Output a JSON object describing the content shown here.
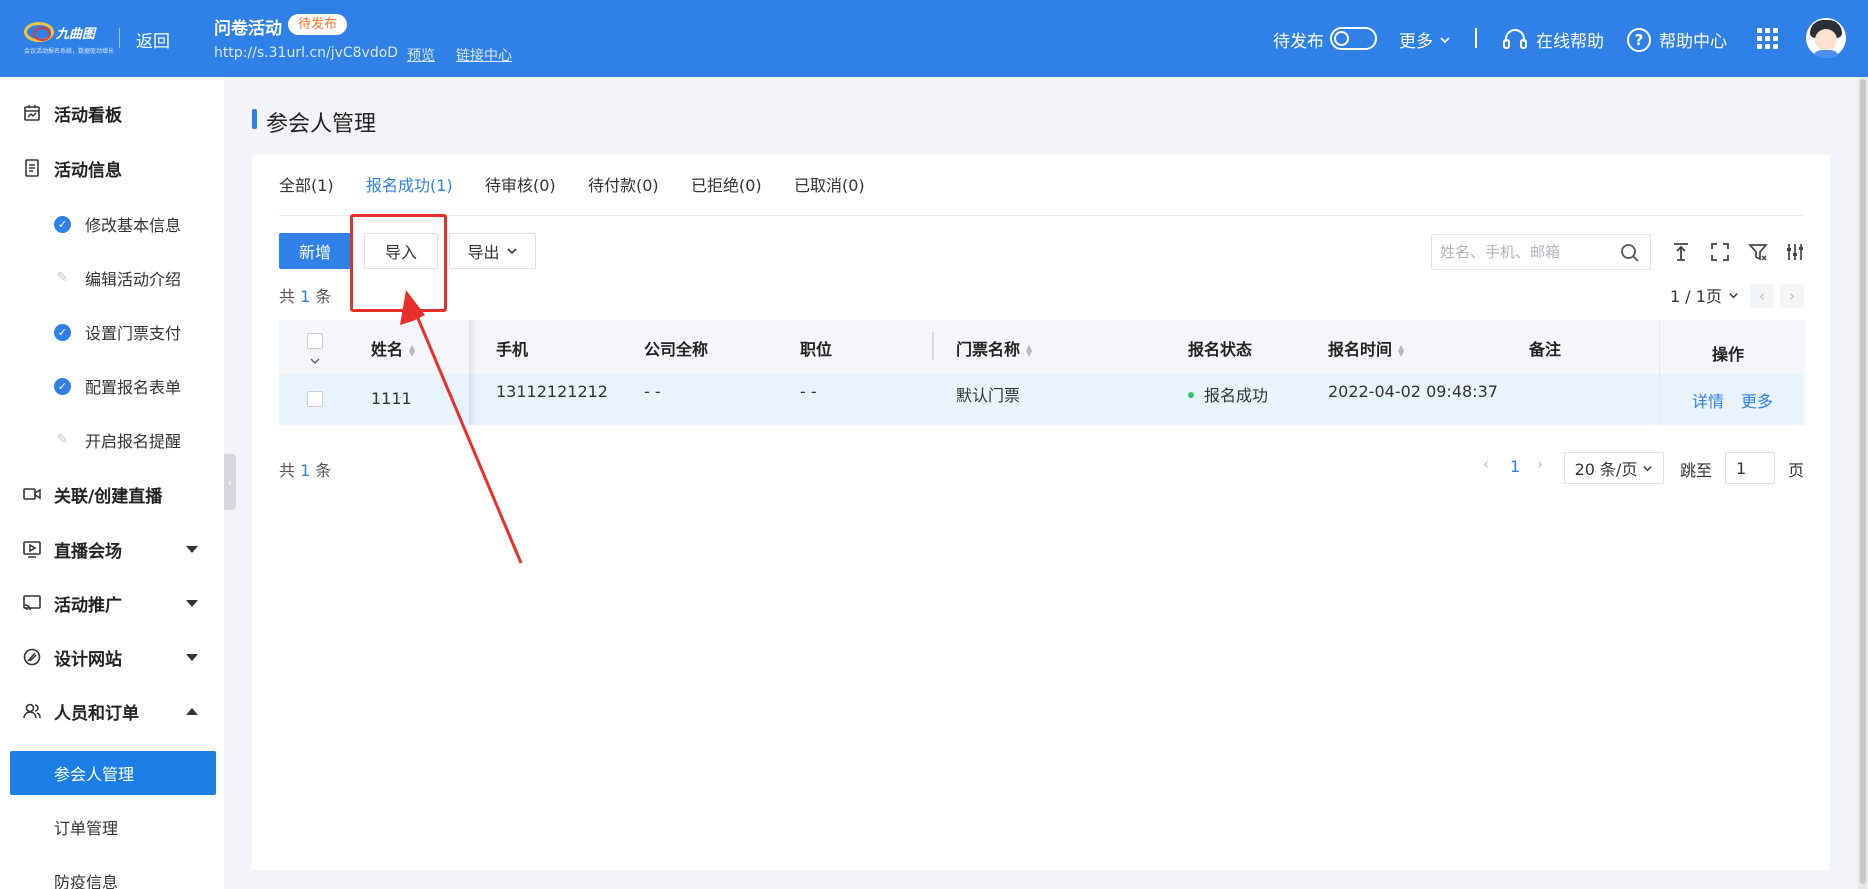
{
  "header": {
    "logo_name": "九曲图",
    "logo_tagline": "会议活动报名系统，数据驱动增长",
    "back_label": "返回",
    "activity_title": "问卷活动",
    "activity_status": "待发布",
    "activity_url": "http://s.31url.cn/jvC8vdoD",
    "preview_label": "预览",
    "link_center_label": "链接中心",
    "publish_toggle_label": "待发布",
    "more_label": "更多",
    "online_help_label": "在线帮助",
    "help_center_label": "帮助中心",
    "colors": {
      "bar": "#2f80e7",
      "status_text": "#f5732a"
    }
  },
  "sidebar": {
    "items": [
      {
        "label": "活动看板",
        "icon": "dashboard-icon"
      },
      {
        "label": "活动信息",
        "icon": "document-icon"
      },
      {
        "label": "修改基本信息",
        "state": "done"
      },
      {
        "label": "编辑活动介绍",
        "state": "todo"
      },
      {
        "label": "设置门票支付",
        "state": "done"
      },
      {
        "label": "配置报名表单",
        "state": "done"
      },
      {
        "label": "开启报名提醒",
        "state": "todo"
      },
      {
        "label": "关联/创建直播",
        "icon": "video-icon"
      },
      {
        "label": "直播会场",
        "icon": "live-venue-icon",
        "expanded": false
      },
      {
        "label": "活动推广",
        "icon": "broadcast-icon",
        "expanded": false
      },
      {
        "label": "设计网站",
        "icon": "design-icon",
        "expanded": false
      },
      {
        "label": "人员和订单",
        "icon": "people-icon",
        "expanded": true
      },
      {
        "label": "参会人管理",
        "active": true
      },
      {
        "label": "订单管理"
      },
      {
        "label": "防疫信息"
      }
    ]
  },
  "main": {
    "page_title": "参会人管理",
    "tabs": [
      {
        "label": "全部(1)"
      },
      {
        "label": "报名成功(1)",
        "active": true
      },
      {
        "label": "待审核(0)"
      },
      {
        "label": "待付款(0)"
      },
      {
        "label": "已拒绝(0)"
      },
      {
        "label": "已取消(0)"
      }
    ],
    "toolbar": {
      "add_label": "新增",
      "import_label": "导入",
      "export_label": "导出",
      "search_placeholder": "姓名、手机、邮箱"
    },
    "count_top": {
      "prefix": "共",
      "num": "1",
      "suffix": "条"
    },
    "page_indicator": "1 / 1页",
    "table": {
      "columns": {
        "name": "姓名",
        "phone": "手机",
        "company": "公司全称",
        "position": "职位",
        "ticket": "门票名称",
        "status": "报名状态",
        "time": "报名时间",
        "remark": "备注",
        "actions": "操作"
      },
      "rows": [
        {
          "name": "1111",
          "phone": "13112121212",
          "company": "- -",
          "position": "- -",
          "ticket": "默认门票",
          "status": "报名成功",
          "time": "2022-04-02 09:48:37",
          "remark": "",
          "detail_label": "详情",
          "more_label": "更多"
        }
      ]
    },
    "pagination": {
      "count_prefix": "共",
      "count_num": "1",
      "count_suffix": "条",
      "current_page": "1",
      "page_size": "20 条/页",
      "jump_label": "跳至",
      "jump_value": "1",
      "page_label": "页"
    }
  }
}
